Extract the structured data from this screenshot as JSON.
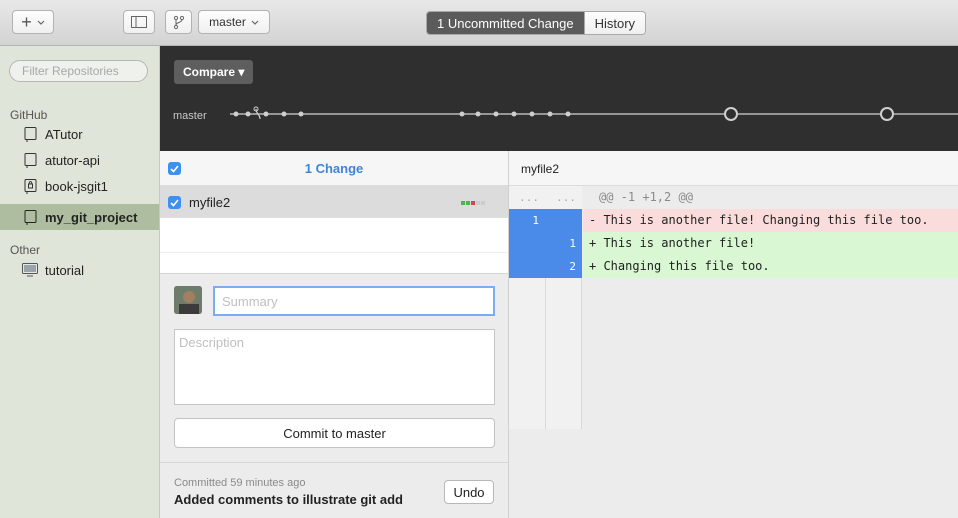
{
  "toolbar": {
    "add_label": "+",
    "branch_label": "master",
    "tabs": [
      {
        "label": "1 Uncommitted Change",
        "active": true
      },
      {
        "label": "History",
        "active": false
      }
    ]
  },
  "sidebar": {
    "filter_placeholder": "Filter Repositories",
    "groups": [
      {
        "label": "GitHub",
        "items": [
          {
            "label": "ATutor",
            "selected": false
          },
          {
            "label": "atutor-api",
            "selected": false
          },
          {
            "label": "book-jsgit1",
            "selected": false
          },
          {
            "label": "my_git_project",
            "selected": true
          }
        ]
      },
      {
        "label": "Other",
        "items": [
          {
            "label": "tutorial",
            "selected": false
          }
        ]
      }
    ]
  },
  "timeline": {
    "compare_label": "Compare ▾",
    "branch": "master"
  },
  "changes": {
    "title": "1 Change",
    "files": [
      {
        "name": "myfile2",
        "checked": true
      }
    ]
  },
  "commit": {
    "summary_placeholder": "Summary",
    "description_placeholder": "Description",
    "commit_button": "Commit to master",
    "last_time": "Committed 59 minutes ago",
    "last_message": "Added comments to illustrate git add",
    "undo_label": "Undo"
  },
  "diff": {
    "file": "myfile2",
    "hunk": {
      "old": "...",
      "new": "...",
      "text": "@@ -1 +1,2 @@"
    },
    "lines": [
      {
        "type": "del",
        "old": "1",
        "new": "",
        "text": "- This is another file! Changing this file too."
      },
      {
        "type": "add",
        "old": "",
        "new": "1",
        "text": "+ This is another file!"
      },
      {
        "type": "add",
        "old": "",
        "new": "2",
        "text": "+ Changing this file too."
      }
    ]
  },
  "colors": {
    "accent": "#3d8ff2",
    "deletion": "#fbdcdc",
    "addition": "#d8f7d2",
    "sidebar_selected": "#aebd9f"
  }
}
